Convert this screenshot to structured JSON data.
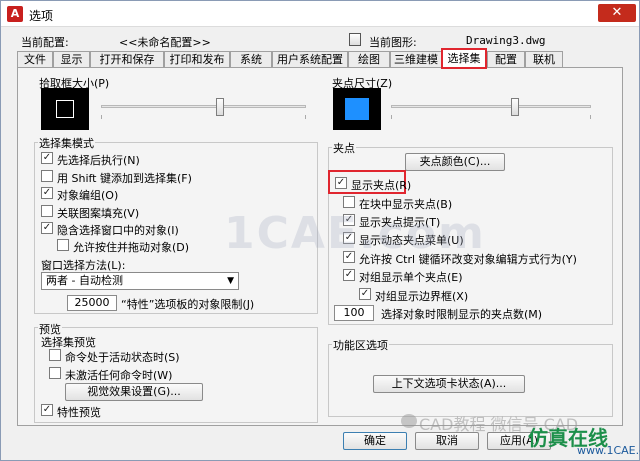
{
  "window": {
    "title": "选项",
    "app_icon": "autocad-a-icon",
    "close_glyph": "✕"
  },
  "header": {
    "current_profile_label": "当前配置:",
    "current_profile_value": "<<未命名配置>>",
    "current_drawing_label": "当前图形:",
    "current_drawing_value": "Drawing3.dwg"
  },
  "tabs": [
    {
      "label": "文件"
    },
    {
      "label": "显示"
    },
    {
      "label": "打开和保存"
    },
    {
      "label": "打印和发布"
    },
    {
      "label": "系统"
    },
    {
      "label": "用户系统配置"
    },
    {
      "label": "绘图"
    },
    {
      "label": "三维建模"
    },
    {
      "label": "选择集",
      "active": true
    },
    {
      "label": "配置"
    },
    {
      "label": "联机"
    }
  ],
  "pickbox": {
    "title": "拾取框大小(P)",
    "slider_level": 0.58
  },
  "selection_modes": {
    "title": "选择集模式",
    "items": [
      {
        "label": "先选择后执行(N)",
        "checked": true
      },
      {
        "label": "用 Shift 键添加到选择集(F)",
        "checked": false
      },
      {
        "label": "对象编组(O)",
        "checked": true
      },
      {
        "label": "关联图案填充(V)",
        "checked": false
      },
      {
        "label": "隐含选择窗口中的对象(I)",
        "checked": true
      },
      {
        "label": "允许按住并拖动对象(D)",
        "checked": false
      }
    ],
    "window_method_label": "窗口选择方法(L):",
    "window_method_value": "两者 - 自动检测",
    "limit_value": "25000",
    "limit_label": "“特性”选项板的对象限制(J)"
  },
  "preview": {
    "title": "预览",
    "subtitle": "选择集预览",
    "items": [
      {
        "label": "命令处于活动状态时(S)",
        "checked": false
      },
      {
        "label": "未激活任何命令时(W)",
        "checked": false
      }
    ],
    "visual_effects_button": "视觉效果设置(G)...",
    "properties_preview": {
      "label": "特性预览",
      "checked": true
    }
  },
  "grip_size": {
    "title": "夹点尺寸(Z)",
    "slider_level": 0.62,
    "color": "#1e90ff"
  },
  "grips": {
    "title": "夹点",
    "colors_button": "夹点颜色(C)...",
    "items": [
      {
        "label": "显示夹点(R)",
        "checked": true
      },
      {
        "label": "在块中显示夹点(B)",
        "checked": false
      },
      {
        "label": "显示夹点提示(T)",
        "checked": true
      },
      {
        "label": "显示动态夹点菜单(U)",
        "checked": true
      },
      {
        "label": "允许按 Ctrl 键循环改变对象编辑方式行为(Y)",
        "checked": true
      },
      {
        "label": "对组显示单个夹点(E)",
        "checked": true
      },
      {
        "label": "对组显示边界框(X)",
        "checked": true
      }
    ],
    "limit_value": "100",
    "limit_label": "选择对象时限制显示的夹点数(M)"
  },
  "ribbon": {
    "title": "功能区选项",
    "contextual_tab_button": "上下文选项卡状态(A)..."
  },
  "footer": {
    "ok": "确定",
    "cancel": "取消",
    "apply": "应用(A)"
  },
  "watermarks": {
    "main": "1CAE.com",
    "wechat": "CAD教程 微信号 CAD",
    "site_cn": "仿真在线",
    "site_url": "www.1CAE.com"
  },
  "colors": {
    "highlight_red": "#e0262f",
    "grip_blue": "#1e90ff",
    "close_red": "#c42b1c"
  }
}
